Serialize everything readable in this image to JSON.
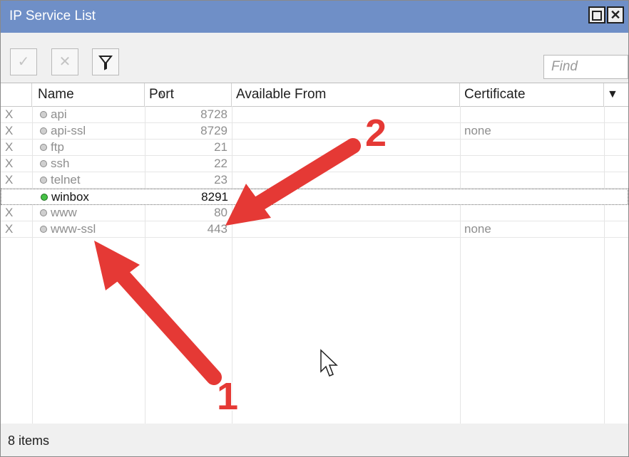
{
  "window": {
    "title": "IP Service List"
  },
  "toolbar": {
    "enable_icon": "✓",
    "disable_icon": "✕",
    "filter_icon": "⧩",
    "find_placeholder": "Find"
  },
  "table": {
    "columns": [
      "Name",
      "Port",
      "Available From",
      "Certificate"
    ],
    "rows": [
      {
        "flag": "X",
        "name": "api",
        "port": "8728",
        "available_from": "",
        "certificate": ""
      },
      {
        "flag": "X",
        "name": "api-ssl",
        "port": "8729",
        "available_from": "",
        "certificate": "none"
      },
      {
        "flag": "X",
        "name": "ftp",
        "port": "21",
        "available_from": "",
        "certificate": ""
      },
      {
        "flag": "X",
        "name": "ssh",
        "port": "22",
        "available_from": "",
        "certificate": ""
      },
      {
        "flag": "X",
        "name": "telnet",
        "port": "23",
        "available_from": "",
        "certificate": ""
      },
      {
        "flag": "",
        "name": "winbox",
        "port": "8291",
        "available_from": "",
        "certificate": "",
        "selected": true
      },
      {
        "flag": "X",
        "name": "www",
        "port": "80",
        "available_from": "",
        "certificate": ""
      },
      {
        "flag": "X",
        "name": "www-ssl",
        "port": "443",
        "available_from": "",
        "certificate": "none"
      }
    ]
  },
  "status": {
    "count_text": "8 items"
  },
  "annotations": {
    "arrow1_label": "1",
    "arrow2_label": "2",
    "arrow_color": "#e53935"
  }
}
